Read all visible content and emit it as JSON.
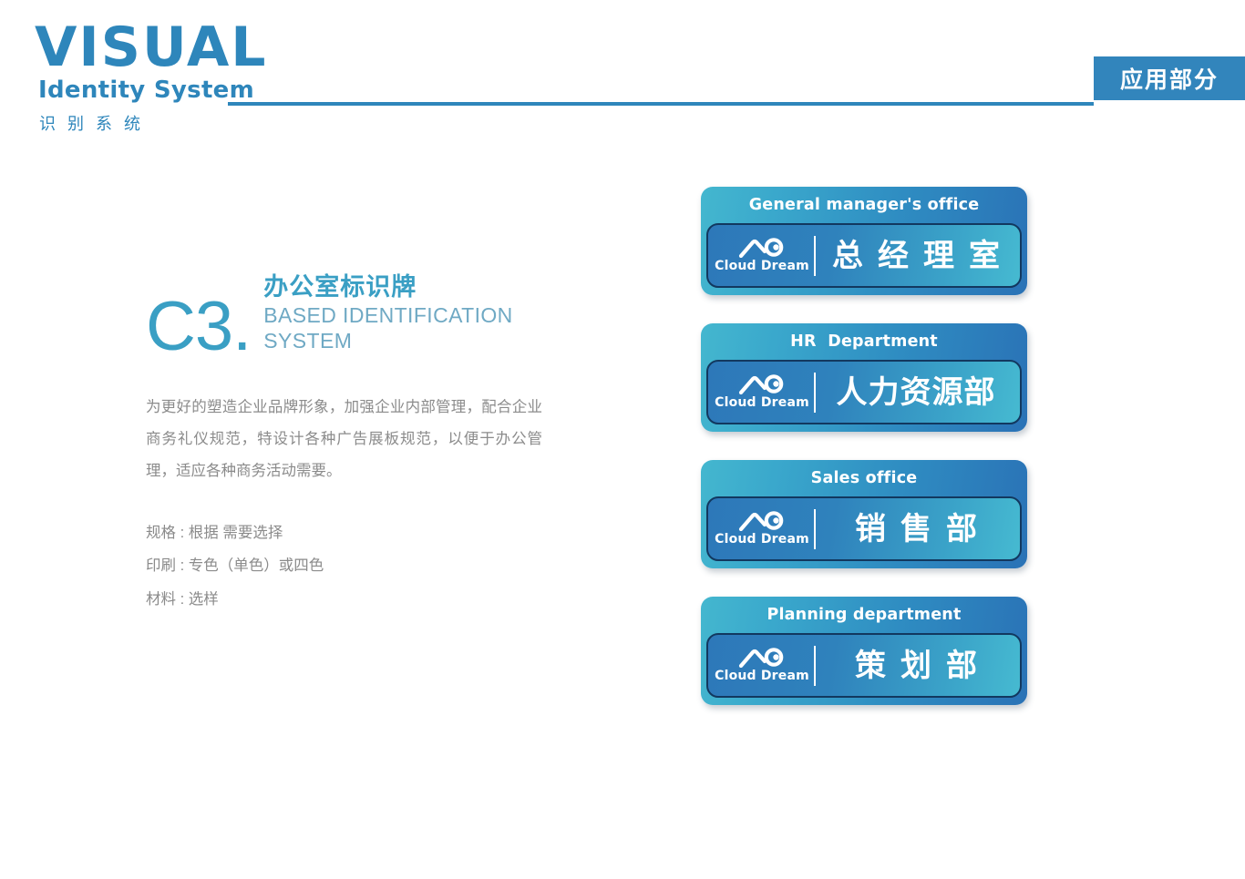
{
  "header": {
    "brand_primary": "VISUAL",
    "brand_secondary": "Identity System",
    "brand_chinese": "识别系统",
    "badge_label": "应用部分"
  },
  "section": {
    "code": "C3.",
    "title_cn": "办公室标识牌",
    "title_en": "BASED  IDENTIFICATION SYSTEM",
    "paragraph": "为更好的塑造企业品牌形象，加强企业内部管理，配合企业商务礼仪规范，特设计各种广告展板规范，以便于办公管理，适应各种商务活动需要。",
    "specs": [
      "规格 : 根据 需要选择",
      "印刷 : 专色（单色）或四色",
      "材料 : 选样"
    ]
  },
  "signs": {
    "logo_wordmark": "Cloud Dream",
    "plates": [
      {
        "english": "General manager's office",
        "chinese": "总经理室",
        "spacing": "wide"
      },
      {
        "english": "HR  Department",
        "chinese": "人力资源部",
        "spacing": "tight"
      },
      {
        "english": "Sales office",
        "chinese": "销售部",
        "spacing": "wide"
      },
      {
        "english": "Planning department",
        "chinese": "策划部",
        "spacing": "wide"
      }
    ]
  },
  "colors": {
    "brand_blue": "#2e86bb",
    "accent_teal": "#3a9fc4",
    "badge_blue": "#3285bc",
    "body_gray": "#8b8b8b",
    "plate_teal": "#44b7cf",
    "plate_blue": "#2a72b6",
    "panel_outline": "#12385f"
  }
}
